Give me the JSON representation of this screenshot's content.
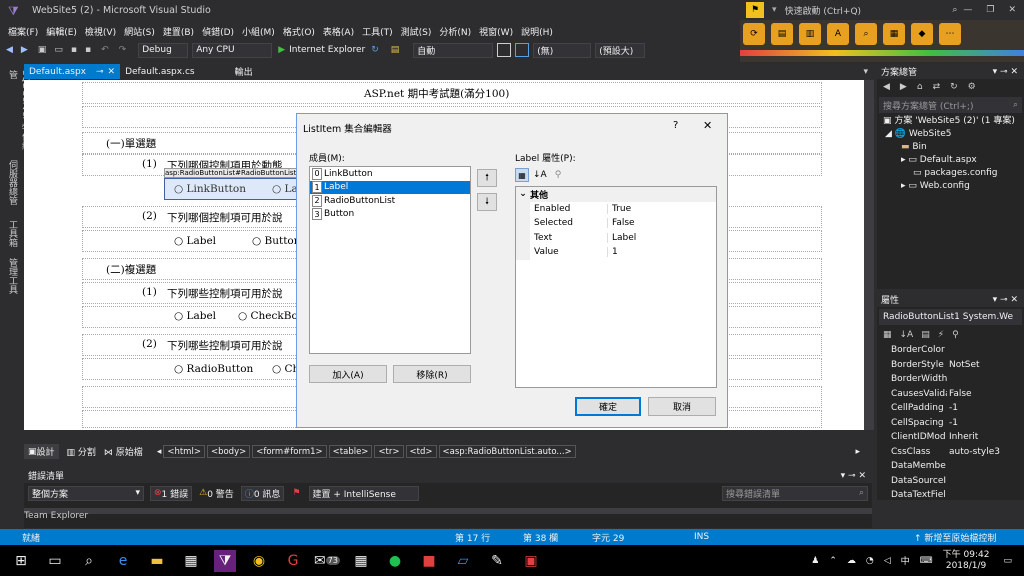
{
  "window": {
    "title": "WebSite5 (2) - Microsoft Visual Studio",
    "quick_launch": "快速啟動 (Ctrl+Q)"
  },
  "menu": [
    "檔案(F)",
    "編輯(E)",
    "檢視(V)",
    "網站(S)",
    "建置(B)",
    "偵錯(D)",
    "小組(M)",
    "格式(O)",
    "表格(A)",
    "工具(T)",
    "測試(S)",
    "分析(N)",
    "視窗(W)",
    "說明(H)"
  ],
  "toolbar": {
    "config": "Debug",
    "platform": "Any CPU",
    "browser": "Internet Explorer",
    "auto": "自動",
    "none": "(無)",
    "font": "(預設大)"
  },
  "tabs": [
    "Default.aspx",
    "Default.aspx.cs",
    "輸出"
  ],
  "left_strip": [
    "SQL Server 物件總管",
    "伺服器總管",
    "工具箱",
    "管理工具"
  ],
  "designer": {
    "heading": "ASP.net 期中考試題(滿分100)",
    "section1": "(一)單選題",
    "q1_num": "(1)",
    "q1": "下列哪個控制項用於動態",
    "smart_tag": "asp:RadioButtonList#RadioButtonList1",
    "q1_opt1": "LinkButton",
    "q1_opt2": "La",
    "q2_num": "(2)",
    "q2": "下列哪個控制項可用於說",
    "q2_opt1": "Label",
    "q2_opt2": "Button",
    "section2": "(二)複選題",
    "q3_num": "(1)",
    "q3": "下列哪些控制項可用於說",
    "q3_opt1": "Label",
    "q3_opt2": "CheckBox",
    "q4_num": "(2)",
    "q4": "下列哪些控制項可用於說",
    "q4_opt1": "RadioButton",
    "q4_opt2": "Ch",
    "bottom_label": "Label"
  },
  "dialog": {
    "title": "ListItem 集合編輯器",
    "help": "?",
    "close": "✕",
    "members_label": "成員(M):",
    "members": [
      {
        "index": "0",
        "text": "LinkButton"
      },
      {
        "index": "1",
        "text": "Label"
      },
      {
        "index": "2",
        "text": "RadioButtonList"
      },
      {
        "index": "3",
        "text": "Button"
      }
    ],
    "selected_index": 1,
    "props_label": "Label 屬性(P):",
    "category": "其他",
    "properties": [
      {
        "name": "Enabled",
        "value": "True"
      },
      {
        "name": "Selected",
        "value": "False"
      },
      {
        "name": "Text",
        "value": "Label"
      },
      {
        "name": "Value",
        "value": "1"
      }
    ],
    "add": "加入(A)",
    "remove": "移除(R)",
    "ok": "確定",
    "cancel": "取消"
  },
  "solution": {
    "title": "方案總管",
    "search": "搜尋方案總管 (Ctrl+;)",
    "items": [
      "方案 'WebSite5 (2)' (1 專案)",
      "WebSite5",
      "Bin",
      "Default.aspx",
      "packages.config",
      "Web.config"
    ]
  },
  "properties": {
    "title": "屬性",
    "object": "RadioButtonList1  System.We",
    "rows": [
      {
        "name": "BorderColor",
        "value": ""
      },
      {
        "name": "BorderStyle",
        "value": "NotSet"
      },
      {
        "name": "BorderWidth",
        "value": ""
      },
      {
        "name": "CausesValidat",
        "value": "False"
      },
      {
        "name": "CellPadding",
        "value": "-1"
      },
      {
        "name": "CellSpacing",
        "value": "-1"
      },
      {
        "name": "ClientIDMod",
        "value": "Inherit"
      },
      {
        "name": "CssClass",
        "value": "auto-style3"
      },
      {
        "name": "DataMembe",
        "value": ""
      },
      {
        "name": "DataSourceI",
        "value": ""
      },
      {
        "name": "DataTextFiel",
        "value": ""
      }
    ]
  },
  "viewbar": {
    "design": "設計",
    "split": "分割",
    "source": "原始檔",
    "crumbs": [
      "<html>",
      "<body>",
      "<form#form1>",
      "<table>",
      "<tr>",
      "<td>",
      "<asp:RadioButtonList.auto...>"
    ]
  },
  "errors": {
    "title": "錯誤清單",
    "scope": "整個方案",
    "errors": "1 錯誤",
    "warnings": "0 警告",
    "messages": "0 訊息",
    "build": "建置 + IntelliSense",
    "search": "搜尋錯誤清單",
    "team": "Team Explorer"
  },
  "status": {
    "ready": "就緒",
    "line": "第 17 行",
    "col": "第 38 欄",
    "ch": "字元 29",
    "ins": "INS",
    "add_source": "新增至原始檔控制"
  },
  "taskbar": {
    "time": "下午 09:42",
    "date": "2018/1/9",
    "ime": "中",
    "badge": "73"
  }
}
